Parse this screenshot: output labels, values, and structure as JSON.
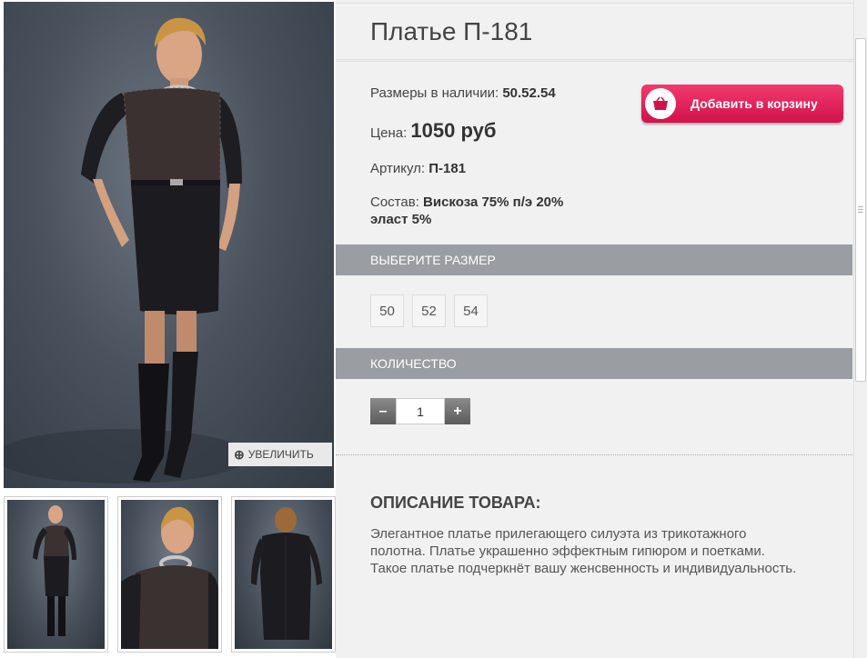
{
  "product": {
    "title": "Платье П-181",
    "sizes_label": "Размеры в наличии:",
    "sizes_value": "50.52.54",
    "price_label": "Цена:",
    "price_value": "1050 руб",
    "article_label": "Артикул:",
    "article_value": "П-181",
    "composition_label": "Состав:",
    "composition_value_1": "Вискоза 75% п/э 20%",
    "composition_value_2": "эласт 5%"
  },
  "cart": {
    "label": "Добавить в корзину",
    "icon": "basket-icon"
  },
  "zoom": {
    "label": "УВЕЛИЧИТЬ",
    "icon": "zoom-in-icon"
  },
  "size_section": {
    "title": "ВЫБЕРИТЕ РАЗМЕР",
    "options": [
      "50",
      "52",
      "54"
    ]
  },
  "quantity_section": {
    "title": "КОЛИЧЕСТВО",
    "minus": "–",
    "value": "1",
    "plus": "+"
  },
  "description": {
    "title": "ОПИСАНИЕ ТОВАРА:",
    "text": "Элегантное платье прилегающего силуэта из трикотажного полотна. Платье украшенно эффектным гипюром и поетками. Такое платье подчеркнёт вашу женсвенность и индивидуальность."
  },
  "colors": {
    "accent": "#e11e55",
    "section_bar": "#9a9da1",
    "panel_bg": "#f1f1f1"
  }
}
